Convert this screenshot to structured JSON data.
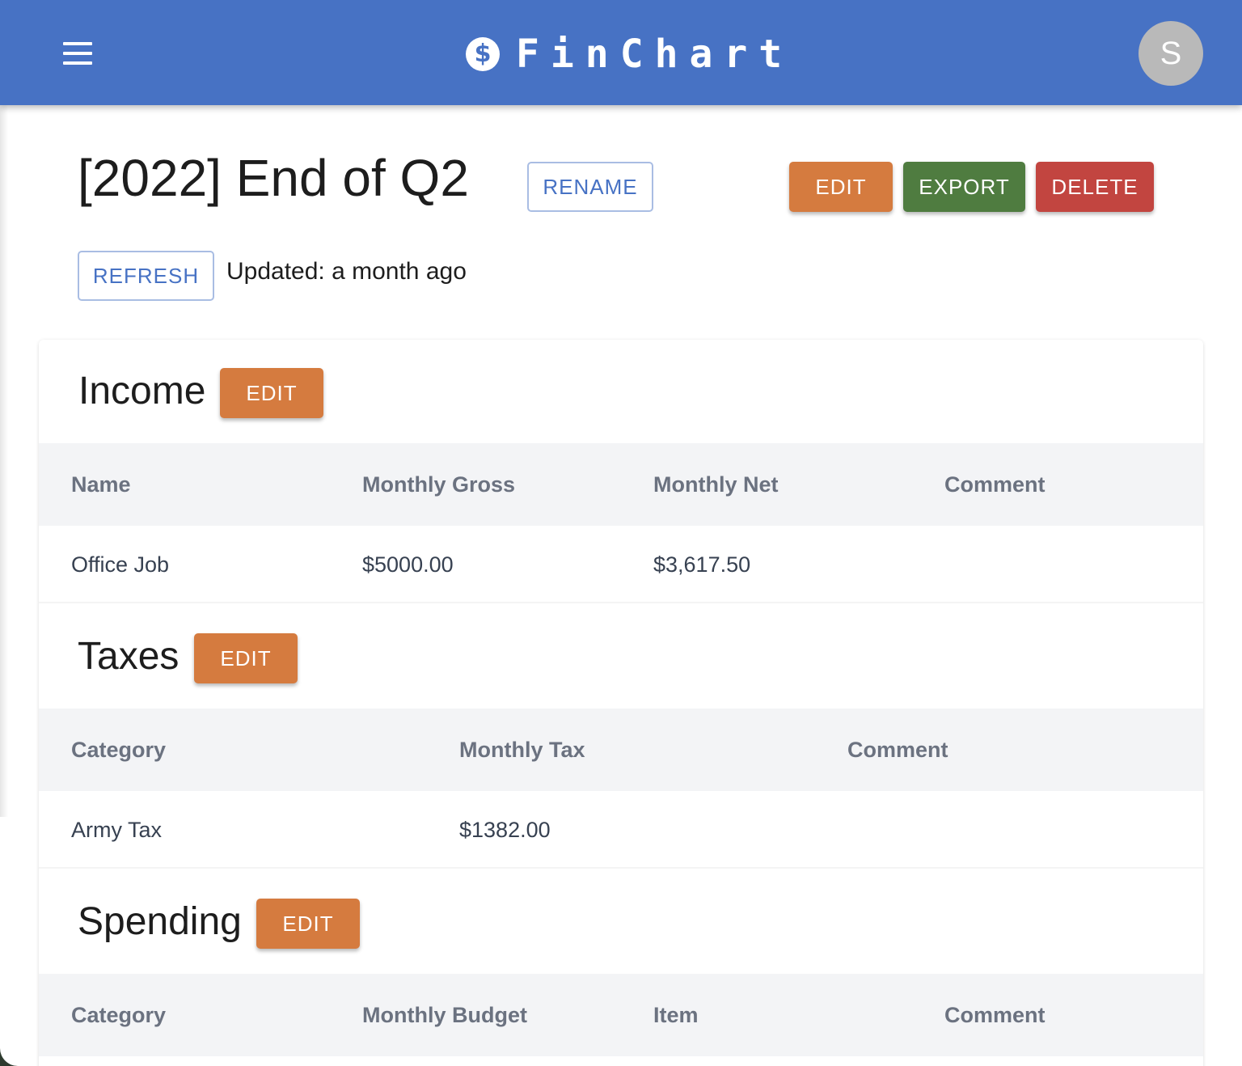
{
  "app": {
    "name": "FinChart",
    "logo_glyph": "$",
    "avatar_initial": "S"
  },
  "page": {
    "title": "[2022] End of Q2",
    "rename_label": "RENAME",
    "edit_label": "EDIT",
    "export_label": "EXPORT",
    "delete_label": "DELETE",
    "refresh_label": "REFRESH",
    "updated_text": "Updated: a month ago"
  },
  "income": {
    "title": "Income",
    "edit_label": "EDIT",
    "columns": [
      "Name",
      "Monthly Gross",
      "Monthly Net",
      "Comment"
    ],
    "rows": [
      [
        "Office Job",
        "$5000.00",
        "$3,617.50",
        ""
      ]
    ]
  },
  "taxes": {
    "title": "Taxes",
    "edit_label": "EDIT",
    "columns": [
      "Category",
      "Monthly Tax",
      "Comment"
    ],
    "rows": [
      [
        "Army Tax",
        "$1382.00",
        ""
      ]
    ]
  },
  "spending": {
    "title": "Spending",
    "edit_label": "EDIT",
    "columns": [
      "Category",
      "Monthly Budget",
      "Item",
      "Comment"
    ]
  },
  "colors": {
    "appbar": "#4772c4",
    "edit": "#d57b3f",
    "export": "#4f7c40",
    "delete": "#c24540"
  },
  "icons": {
    "menu": "menu-icon",
    "logo": "dollar-circle-icon"
  }
}
